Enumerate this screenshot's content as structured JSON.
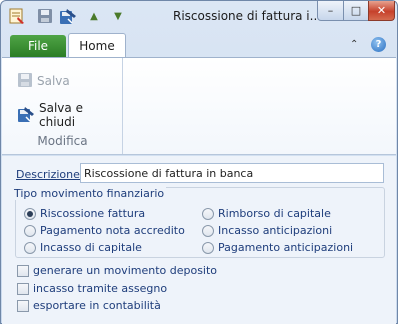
{
  "window": {
    "title": "Riscossione di fattura i...",
    "minimize_glyph": "–",
    "maximize_glyph": "□",
    "close_glyph": "✕"
  },
  "quick_access": {
    "icons": [
      "app-form-icon",
      "save-icon",
      "save-and-close-icon",
      "move-up-icon",
      "move-down-icon"
    ],
    "up_glyph": "▲",
    "down_glyph": "▼"
  },
  "ribbon": {
    "tabs": [
      {
        "label": "File",
        "selected": false
      },
      {
        "label": "Home",
        "selected": true
      }
    ],
    "collapse_glyph": "⌃",
    "help_glyph": "?",
    "groups": [
      {
        "label": "Modifica",
        "buttons": [
          {
            "label": "Salva",
            "enabled": false,
            "icon": "save-icon"
          },
          {
            "label": "Salva e chiudi",
            "enabled": true,
            "icon": "save-and-close-icon"
          }
        ]
      }
    ]
  },
  "form": {
    "description_label": "Descrizione:",
    "description_value": "Riscossione di fattura in banca",
    "movement_group": {
      "legend": "Tipo movimento finanziario",
      "options": [
        {
          "label": "Riscossione fattura",
          "selected": true
        },
        {
          "label": "Pagamento nota accredito",
          "selected": false
        },
        {
          "label": "Incasso di capitale",
          "selected": false
        },
        {
          "label": "Rimborso di capitale",
          "selected": false
        },
        {
          "label": "Incasso anticipazioni",
          "selected": false
        },
        {
          "label": "Pagamento anticipazioni",
          "selected": false
        }
      ]
    },
    "checkboxes": [
      {
        "label": "generare un movimento deposito",
        "checked": false
      },
      {
        "label": "incasso tramite assegno",
        "checked": false
      },
      {
        "label": "esportare in contabilità",
        "checked": false
      }
    ]
  },
  "colors": {
    "file_tab": "#2b7d25",
    "label_text": "#1e3d7b",
    "close_button": "#c6412b"
  }
}
